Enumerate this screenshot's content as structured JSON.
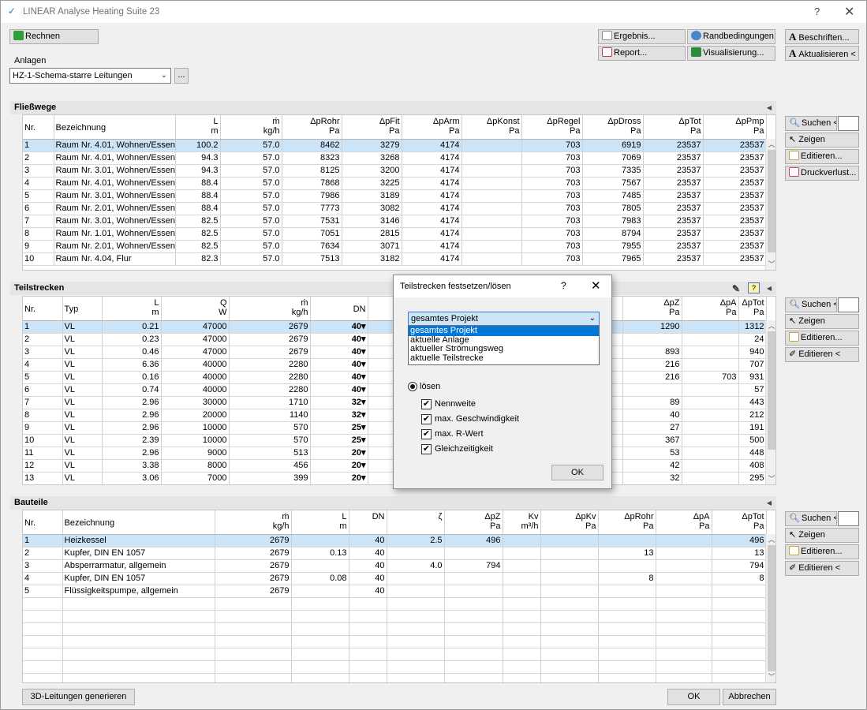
{
  "window": {
    "title": "LINEAR Analyse Heating Suite 23",
    "help": "?",
    "close": "✕"
  },
  "toolbar": {
    "rechnen": "Rechnen",
    "ergebnis": "Ergebnis...",
    "report": "Report...",
    "randbedingungen": "Randbedingungen...",
    "visualisierung": "Visualisierung...",
    "beschriften": "Beschriften...",
    "aktualisieren": "Aktualisieren <"
  },
  "anlagen": {
    "label": "Anlagen",
    "value": "HZ-1-Schema-starre Leitungen",
    "more": "..."
  },
  "fliesswege": {
    "title": "Fließwege",
    "columns": [
      {
        "h": "Nr.",
        "u": ""
      },
      {
        "h": "Bezeichnung",
        "u": ""
      },
      {
        "h": "L",
        "u": "m"
      },
      {
        "h": "ṁ",
        "u": "kg/h"
      },
      {
        "h": "ΔpRohr",
        "u": "Pa"
      },
      {
        "h": "ΔpFit",
        "u": "Pa"
      },
      {
        "h": "ΔpArm",
        "u": "Pa"
      },
      {
        "h": "ΔpKonst",
        "u": "Pa"
      },
      {
        "h": "ΔpRegel",
        "u": "Pa"
      },
      {
        "h": "ΔpDross",
        "u": "Pa"
      },
      {
        "h": "ΔpTot",
        "u": "Pa"
      },
      {
        "h": "ΔpPmp",
        "u": "Pa"
      }
    ],
    "rows": [
      [
        "1",
        "Raum Nr. 4.01, Wohnen/Essen",
        "100.2",
        "57.0",
        "8462",
        "3279",
        "4174",
        "",
        "703",
        "6919",
        "23537",
        "23537"
      ],
      [
        "2",
        "Raum Nr. 4.01, Wohnen/Essen",
        "94.3",
        "57.0",
        "8323",
        "3268",
        "4174",
        "",
        "703",
        "7069",
        "23537",
        "23537"
      ],
      [
        "3",
        "Raum Nr. 3.01, Wohnen/Essen",
        "94.3",
        "57.0",
        "8125",
        "3200",
        "4174",
        "",
        "703",
        "7335",
        "23537",
        "23537"
      ],
      [
        "4",
        "Raum Nr. 4.01, Wohnen/Essen",
        "88.4",
        "57.0",
        "7868",
        "3225",
        "4174",
        "",
        "703",
        "7567",
        "23537",
        "23537"
      ],
      [
        "5",
        "Raum Nr. 3.01, Wohnen/Essen",
        "88.4",
        "57.0",
        "7986",
        "3189",
        "4174",
        "",
        "703",
        "7485",
        "23537",
        "23537"
      ],
      [
        "6",
        "Raum Nr. 2.01, Wohnen/Essen",
        "88.4",
        "57.0",
        "7773",
        "3082",
        "4174",
        "",
        "703",
        "7805",
        "23537",
        "23537"
      ],
      [
        "7",
        "Raum Nr. 3.01, Wohnen/Essen",
        "82.5",
        "57.0",
        "7531",
        "3146",
        "4174",
        "",
        "703",
        "7983",
        "23537",
        "23537"
      ],
      [
        "8",
        "Raum Nr. 1.01, Wohnen/Essen",
        "82.5",
        "57.0",
        "7051",
        "2815",
        "4174",
        "",
        "703",
        "8794",
        "23537",
        "23537"
      ],
      [
        "9",
        "Raum Nr. 2.01, Wohnen/Essen",
        "82.5",
        "57.0",
        "7634",
        "3071",
        "4174",
        "",
        "703",
        "7955",
        "23537",
        "23537"
      ],
      [
        "10",
        "Raum Nr. 4.04, Flur",
        "82.3",
        "57.0",
        "7513",
        "3182",
        "4174",
        "",
        "703",
        "7965",
        "23537",
        "23537"
      ]
    ],
    "buttons": {
      "suchen": "Suchen <",
      "zeigen": "Zeigen",
      "editieren": "Editieren...",
      "druckverlust": "Druckverlust..."
    }
  },
  "teilstrecken": {
    "title": "Teilstrecken",
    "columns": [
      {
        "h": "Nr.",
        "u": ""
      },
      {
        "h": "Typ",
        "u": ""
      },
      {
        "h": "L",
        "u": "m"
      },
      {
        "h": "Q",
        "u": "W"
      },
      {
        "h": "ṁ",
        "u": "kg/h"
      },
      {
        "h": "DN",
        "u": ""
      },
      {
        "h": "ΔpZ",
        "u": "Pa"
      },
      {
        "h": "ΔpA",
        "u": "Pa"
      },
      {
        "h": "ΔpTot",
        "u": "Pa"
      }
    ],
    "rows": [
      [
        "1",
        "VL",
        "0.21",
        "47000",
        "2679",
        "40",
        "1290",
        "",
        "1312"
      ],
      [
        "2",
        "VL",
        "0.23",
        "47000",
        "2679",
        "40",
        "",
        "",
        "24"
      ],
      [
        "3",
        "VL",
        "0.46",
        "47000",
        "2679",
        "40",
        "893",
        "",
        "940"
      ],
      [
        "4",
        "VL",
        "6.36",
        "40000",
        "2280",
        "40",
        "216",
        "",
        "707"
      ],
      [
        "5",
        "VL",
        "0.16",
        "40000",
        "2280",
        "40",
        "216",
        "703",
        "931"
      ],
      [
        "6",
        "VL",
        "0.74",
        "40000",
        "2280",
        "40",
        "",
        "",
        "57"
      ],
      [
        "7",
        "VL",
        "2.96",
        "30000",
        "1710",
        "32",
        "89",
        "",
        "443"
      ],
      [
        "8",
        "VL",
        "2.96",
        "20000",
        "1140",
        "32",
        "40",
        "",
        "212"
      ],
      [
        "9",
        "VL",
        "2.96",
        "10000",
        "570",
        "25",
        "27",
        "",
        "191"
      ],
      [
        "10",
        "VL",
        "2.39",
        "10000",
        "570",
        "25",
        "367",
        "",
        "500"
      ],
      [
        "11",
        "VL",
        "2.96",
        "9000",
        "513",
        "20",
        "53",
        "",
        "448"
      ],
      [
        "12",
        "VL",
        "3.38",
        "8000",
        "456",
        "20",
        "42",
        "",
        "408"
      ],
      [
        "13",
        "VL",
        "3.06",
        "7000",
        "399",
        "20",
        "32",
        "",
        "295"
      ]
    ],
    "buttons": {
      "suchen": "Suchen <",
      "zeigen": "Zeigen",
      "editieren": "Editieren...",
      "editieren2": "Editieren <"
    }
  },
  "bauteile": {
    "title": "Bauteile",
    "columns": [
      {
        "h": "Nr.",
        "u": ""
      },
      {
        "h": "Bezeichnung",
        "u": ""
      },
      {
        "h": "ṁ",
        "u": "kg/h"
      },
      {
        "h": "L",
        "u": "m"
      },
      {
        "h": "DN",
        "u": ""
      },
      {
        "h": "ζ",
        "u": ""
      },
      {
        "h": "ΔpZ",
        "u": "Pa"
      },
      {
        "h": "Kv",
        "u": "m³/h"
      },
      {
        "h": "ΔpKv",
        "u": "Pa"
      },
      {
        "h": "ΔpRohr",
        "u": "Pa"
      },
      {
        "h": "ΔpA",
        "u": "Pa"
      },
      {
        "h": "ΔpTot",
        "u": "Pa"
      }
    ],
    "rows": [
      [
        "1",
        "Heizkessel",
        "2679",
        "",
        "40",
        "2.5",
        "496",
        "",
        "",
        "",
        "",
        "496"
      ],
      [
        "2",
        "Kupfer, DIN EN 1057",
        "2679",
        "0.13",
        "40",
        "",
        "",
        "",
        "",
        "13",
        "",
        "13"
      ],
      [
        "3",
        "Absperrarmatur, allgemein",
        "2679",
        "",
        "40",
        "4.0",
        "794",
        "",
        "",
        "",
        "",
        "794"
      ],
      [
        "4",
        "Kupfer, DIN EN 1057",
        "2679",
        "0.08",
        "40",
        "",
        "",
        "",
        "",
        "8",
        "",
        "8"
      ],
      [
        "5",
        "Flüssigkeitspumpe, allgemein",
        "2679",
        "",
        "40",
        "",
        "",
        "",
        "",
        "",
        "",
        ""
      ]
    ],
    "buttons": {
      "suchen": "Suchen <",
      "zeigen": "Zeigen",
      "editieren": "Editieren...",
      "editieren2": "Editieren <"
    }
  },
  "footer": {
    "generate": "3D-Leitungen generieren",
    "ok": "OK",
    "cancel": "Abbrechen"
  },
  "dialog": {
    "title": "Teilstrecken festsetzen/lösen",
    "help": "?",
    "close": "✕",
    "scope_value": "gesamtes Projekt",
    "scope_options": [
      "gesamtes Projekt",
      "aktuelle Anlage",
      "aktueller Strömungsweg",
      "aktuelle Teilstrecke"
    ],
    "radio_label": "lösen",
    "checks": [
      "Nennweite",
      "max. Geschwindigkeit",
      "max. R-Wert",
      "Gleichzeitigkeit"
    ],
    "ok": "OK"
  },
  "colors": {
    "selected_row": "#cce4f7",
    "highlight": "#0078d7",
    "section_header": "#e5e5e5"
  }
}
